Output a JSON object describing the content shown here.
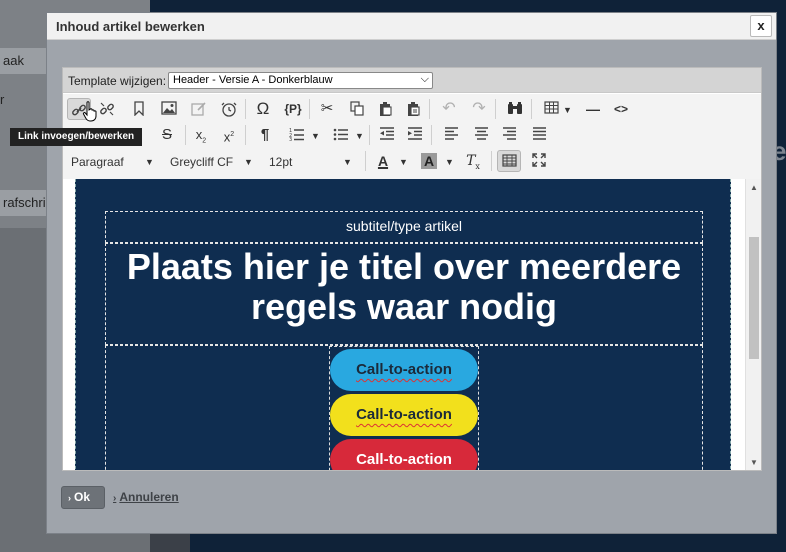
{
  "background": {
    "items": [
      "aak",
      "r",
      "rafschri"
    ],
    "right_letter": "e"
  },
  "dialog": {
    "title": "Inhoud artikel bewerken",
    "close_label": "x"
  },
  "template": {
    "label": "Template wijzigen:",
    "selected": "Header - Versie A - Donkerblauw"
  },
  "toolbar": {
    "tooltip": "Link invoegen/bewerken",
    "format": "Paragraaf",
    "font": "Greycliff CF",
    "size": "12pt"
  },
  "content": {
    "subtitle": "subtitel/type artikel",
    "title": "Plaats hier je titel over meerdere regels waar nodig",
    "ctas": [
      {
        "label": "Call-to-action",
        "bg": "#29a8e0",
        "color": "#1b2a3a"
      },
      {
        "label": "Call-to-action",
        "bg": "#f2e01c",
        "color": "#1b2a3a"
      },
      {
        "label": "Call-to-action",
        "bg": "#d7293a",
        "color": "#ffffff"
      }
    ]
  },
  "footer": {
    "ok_label": "Ok",
    "cancel_label": "Annuleren"
  }
}
